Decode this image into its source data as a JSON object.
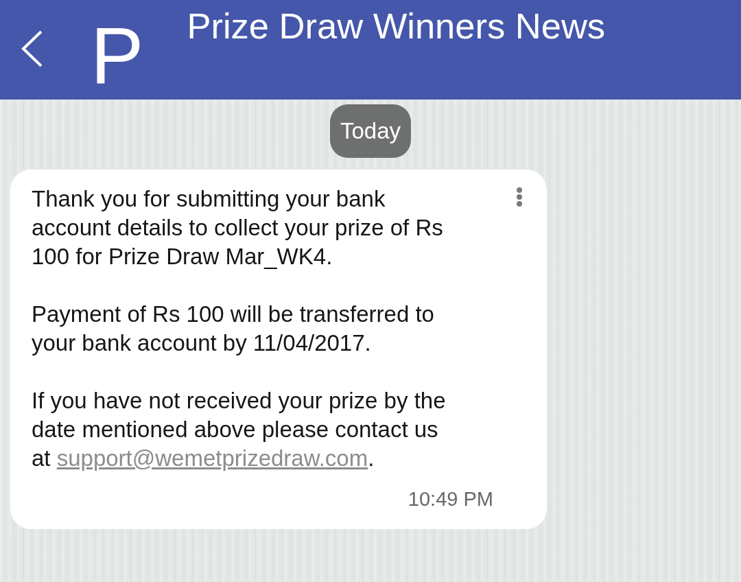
{
  "header": {
    "avatar_letter": "P",
    "title": "Prize Draw Winners News"
  },
  "date_chip": "Today",
  "messages": [
    {
      "paragraphs": [
        {
          "text": "Thank you for submitting your bank\naccount details to collect your prize of Rs\n100 for Prize Draw Mar_WK4."
        },
        {
          "text": "Payment of Rs 100 will be transferred to\nyour bank account by 11/04/2017."
        },
        {
          "text": "If you have not received your prize by the\ndate mentioned above please contact us\nat",
          "link": "support@wemetprizedraw.com",
          "after": "."
        }
      ],
      "time": "10:49 PM"
    }
  ]
}
